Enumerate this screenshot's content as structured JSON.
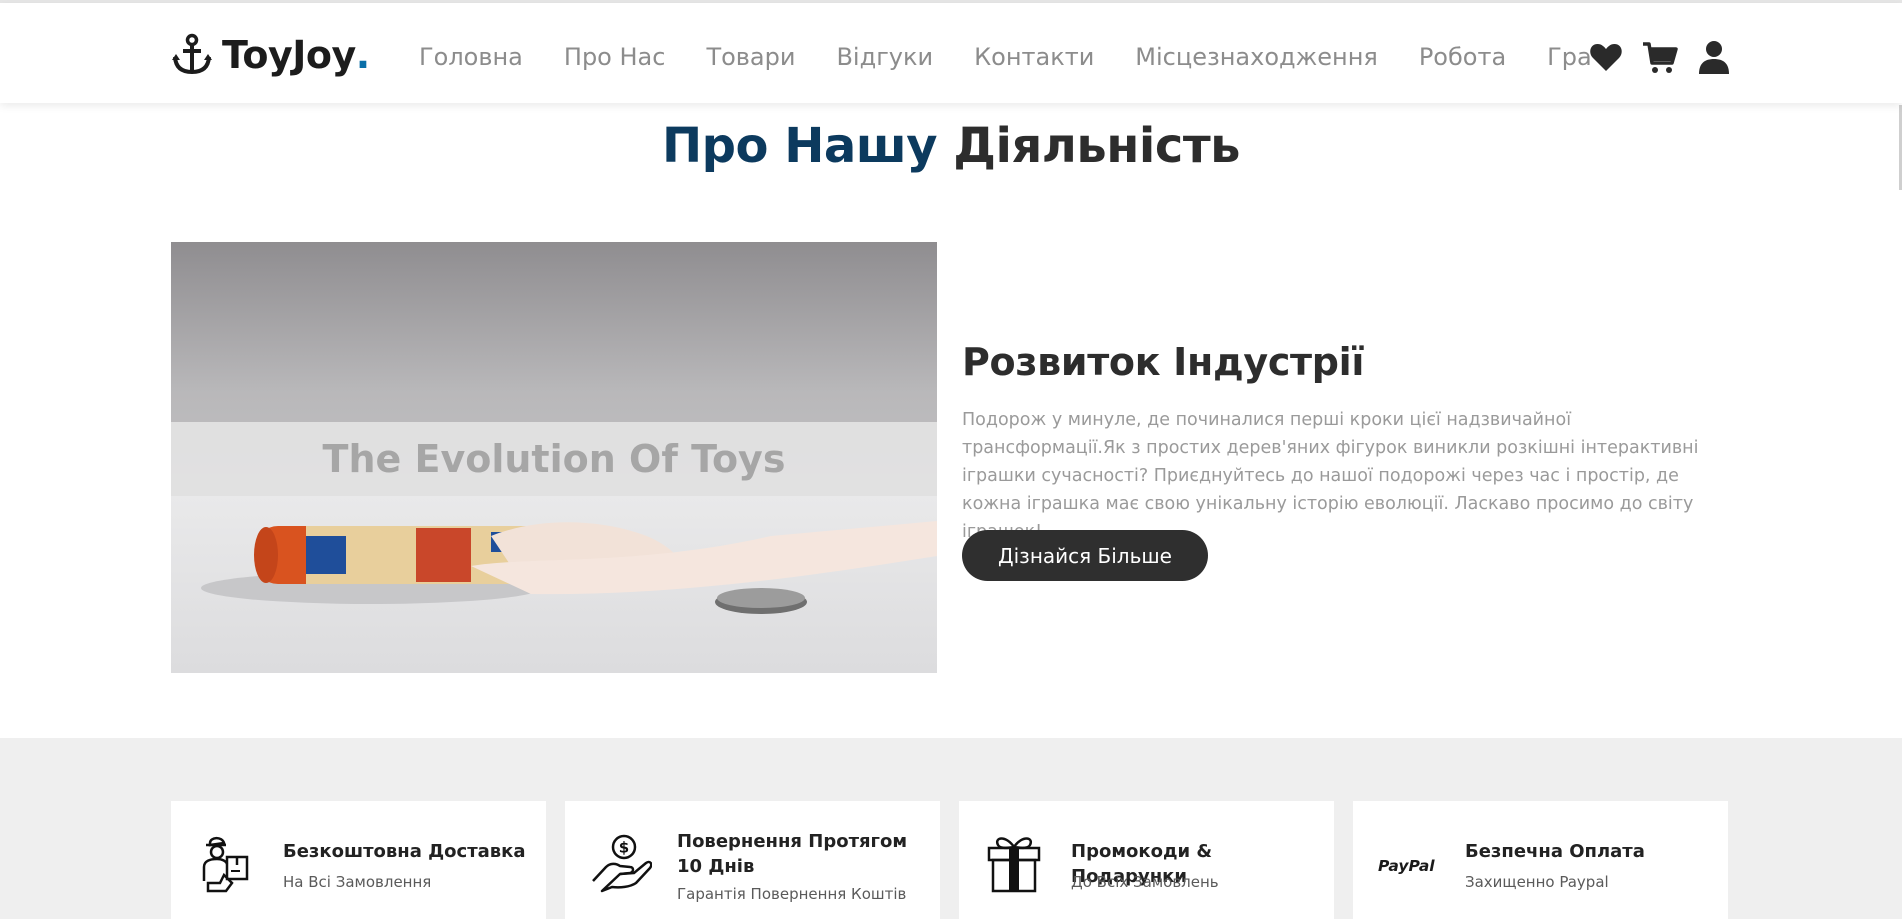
{
  "header": {
    "logo_text": "ToyJoy",
    "logo_dot": ".",
    "nav": [
      "Головна",
      "Про Нас",
      "Товари",
      "Відгуки",
      "Контакти",
      "Місцезнаходження",
      "Робота",
      "Гра"
    ],
    "icons": [
      "heart-icon",
      "cart-icon",
      "user-icon"
    ]
  },
  "section": {
    "title_part1": "Про Нашу",
    "title_part2": "Діяльність"
  },
  "video": {
    "caption": "The Evolution Of Toys"
  },
  "about": {
    "heading": "Розвиток Індустрії",
    "text": "Подорож у минуле, де починалися перші кроки цієї надзвичайної трансформації.Як з простих дерев'яних фігурок виникли розкішні інтерактивні іграшки сучасності? Приєднуйтесь до нашої подорожі через час і простір, де кожна іграшка має свою унікальну історію еволюції. Ласкаво просимо до світу іграшок!",
    "button": "Дізнайся Більше"
  },
  "features": [
    {
      "icon": "delivery-courier-icon",
      "title": "Безкоштовна Доставка",
      "subtitle": "На Всі Замовлення"
    },
    {
      "icon": "money-back-hand-icon",
      "title": "Повернення Протягом 10 Днів",
      "subtitle": "Гарантія Повернення Коштів"
    },
    {
      "icon": "gift-box-icon",
      "title": "Промокоди & Подарунки",
      "subtitle": "До Всіх Замовлень"
    },
    {
      "icon": "paypal-icon",
      "title": "Безпечна Оплата",
      "subtitle": "Захищенно Paypal",
      "icon_text": "PayPal"
    }
  ],
  "colors": {
    "title_accent": "#0c3a5e",
    "logo_dot": "#0a6fa8",
    "button_bg": "#2f2f2f",
    "features_bg": "#efefef"
  }
}
